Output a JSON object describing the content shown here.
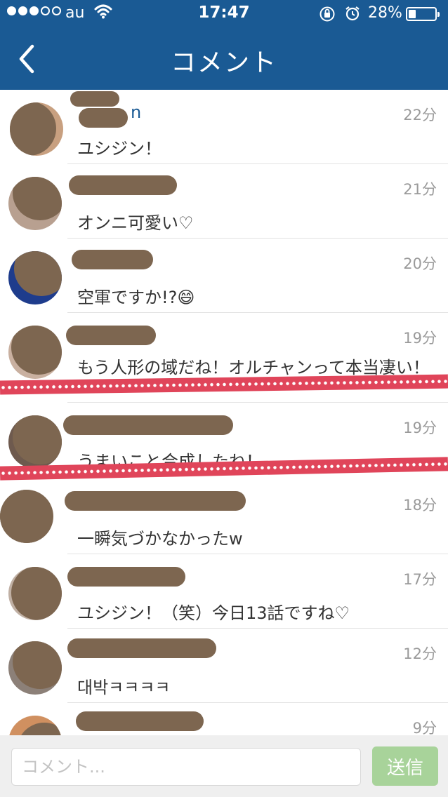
{
  "status_bar": {
    "carrier": "au",
    "time": "17:47",
    "battery_percent_text": "28%",
    "battery_level": 0.28,
    "icons": [
      "signal-dots-icon",
      "wifi-icon",
      "rotation-lock-icon",
      "alarm-icon",
      "battery-icon"
    ]
  },
  "nav": {
    "title": "コメント",
    "back_icon": "chevron-left-icon"
  },
  "comments": [
    {
      "username": "n",
      "time": "22分",
      "text": "ユシジン！"
    },
    {
      "username": "",
      "time": "21分",
      "text": "オンニ可愛い♡"
    },
    {
      "username": "",
      "time": "20分",
      "text": "空軍ですか!?😄"
    },
    {
      "username": "",
      "time": "19分",
      "text": "もう人形の域だね！オルチャンって本当凄い！"
    },
    {
      "username": "",
      "time": "19分",
      "text": "うまいこと合成したね！"
    },
    {
      "username": "",
      "time": "18分",
      "text": "一瞬気づかなかったw"
    },
    {
      "username": "",
      "time": "17分",
      "text": "ユシジン！（笑）今日13話ですね♡"
    },
    {
      "username": "",
      "time": "12分",
      "text": "대박ㅋㅋㅋㅋ"
    },
    {
      "username": "",
      "time": "9分",
      "text": ""
    }
  ],
  "input": {
    "placeholder": "コメント...",
    "value": "",
    "send_label": "送信"
  },
  "colors": {
    "nav_bar": "#1a5a94",
    "send_button": "#a8d39a",
    "ribbon": "#e0455a"
  }
}
